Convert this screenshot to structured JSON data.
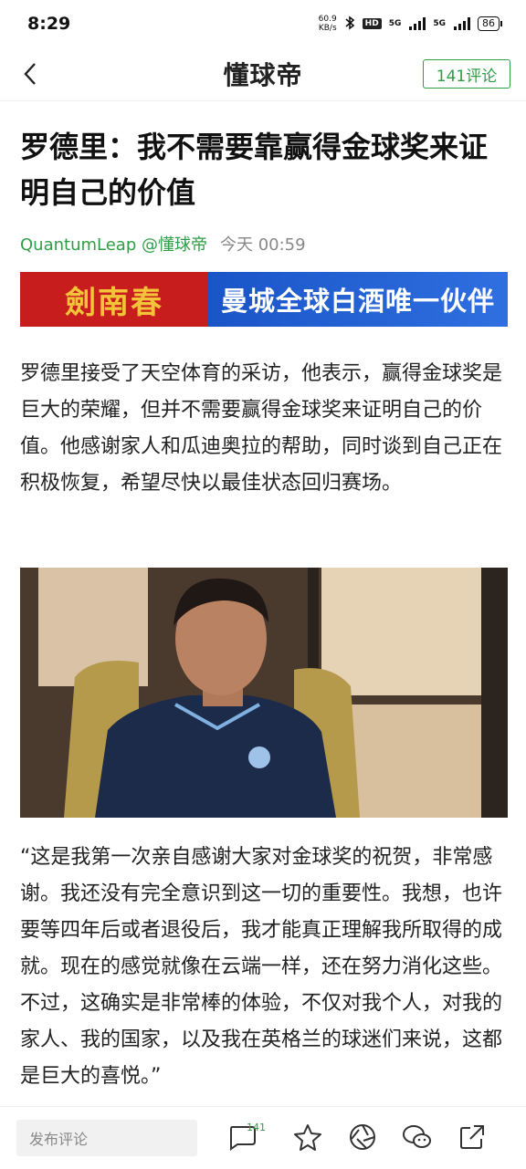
{
  "status_bar": {
    "time": "8:29",
    "net_speed_value": "60.9",
    "net_speed_unit": "KB/s",
    "hd_label": "HD",
    "net1": "5G",
    "net2": "5G",
    "battery": "86"
  },
  "header": {
    "logo": "懂球帝",
    "comment_button": "141评论"
  },
  "article": {
    "title": "罗德里：我不需要靠赢得金球奖来证明自己的价值",
    "author": "QuantumLeap @懂球帝",
    "time": "今天 00:59",
    "ad_left": "劍南春",
    "ad_right": "曼城全球白酒唯一伙伴",
    "paragraph1": "罗德里接受了天空体育的采访，他表示，赢得金球奖是巨大的荣耀，但并不需要赢得金球奖来证明自己的价值。他感谢家人和瓜迪奥拉的帮助，同时谈到自己正在积极恢复，希望尽快以最佳状态回归赛场。",
    "paragraph2": "“这是我第一次亲自感谢大家对金球奖的祝贺，非常感谢。我还没有完全意识到这一切的重要性。我想，也许要等四年后或者退役后，我才能真正理解我所取得的成就。现在的感觉就像在云端一样，还在努力消化这些。不过，这确实是非常棒的体验，不仅对我个人，对我的家人、我的国家，以及我在英格兰的球迷们来说，这都是巨大的喜悦。”"
  },
  "bottom_bar": {
    "comment_placeholder": "发布评论",
    "comment_count": "141"
  },
  "colors": {
    "accent": "#2e9e46",
    "ad_red": "#c81d1d",
    "ad_blue": "#1a55c8"
  }
}
